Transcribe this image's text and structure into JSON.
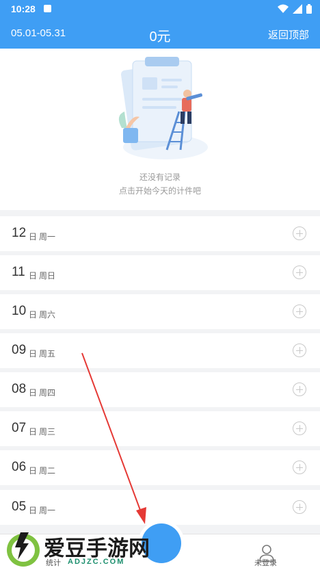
{
  "status_bar": {
    "time": "10:28"
  },
  "header": {
    "date_range": "05.01-05.31",
    "total": "0元",
    "back_to_top": "返回顶部"
  },
  "empty_state": {
    "line1": "还没有记录",
    "line2": "点击开始今天的计件吧"
  },
  "days": [
    {
      "day": "12",
      "suffix": "日",
      "weekday": "周一"
    },
    {
      "day": "11",
      "suffix": "日",
      "weekday": "周日"
    },
    {
      "day": "10",
      "suffix": "日",
      "weekday": "周六"
    },
    {
      "day": "09",
      "suffix": "日",
      "weekday": "周五"
    },
    {
      "day": "08",
      "suffix": "日",
      "weekday": "周四"
    },
    {
      "day": "07",
      "suffix": "日",
      "weekday": "周三"
    },
    {
      "day": "06",
      "suffix": "日",
      "weekday": "周二"
    },
    {
      "day": "05",
      "suffix": "日",
      "weekday": "周一"
    }
  ],
  "bottom_nav": {
    "stats_label": "统计",
    "login_label": "未登录"
  },
  "watermark": {
    "title": "爱豆手游网",
    "url": "ADJZC.COM"
  },
  "colors": {
    "accent": "#3f9ef4",
    "background": "#f2f3f5",
    "arrow": "#e53935"
  }
}
